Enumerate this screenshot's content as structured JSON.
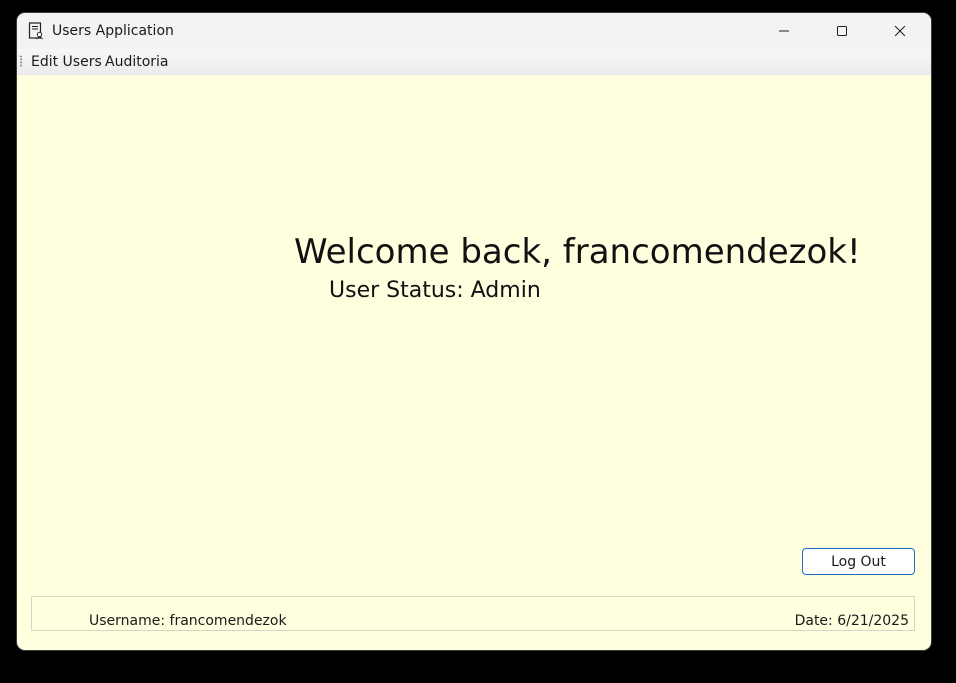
{
  "window": {
    "title": "Users Application",
    "icon": "app-document-icon"
  },
  "titlebar_buttons": {
    "minimize": "minimize-icon",
    "maximize": "maximize-icon",
    "close": "close-icon"
  },
  "menu": {
    "items": [
      {
        "label": "Edit Users"
      },
      {
        "label": "Auditoria"
      }
    ]
  },
  "main": {
    "welcome": "Welcome back, francomendezok!",
    "status": "User Status: Admin",
    "logout_label": "Log Out"
  },
  "statusbar": {
    "username": "Username: francomendezok",
    "date": "Date: 6/21/2025"
  },
  "colors": {
    "background": "#ffffe0",
    "accent": "#1f6fbf"
  }
}
